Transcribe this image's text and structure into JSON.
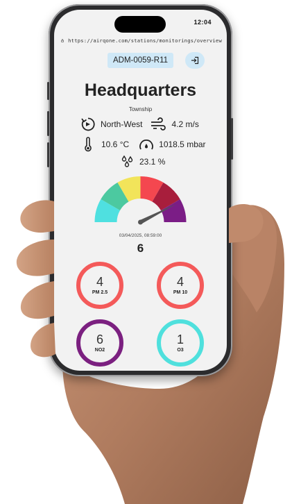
{
  "status_bar": {
    "time": "12:04"
  },
  "browser": {
    "url": "https://airqone.com/stations/monitorings/overview"
  },
  "header": {
    "station_id": "ADM-0059-R11",
    "logout_icon": "logout-icon"
  },
  "station": {
    "name": "Headquarters",
    "location": "Township"
  },
  "weather": {
    "wind_direction": "North-West",
    "wind_speed": "4.2 m/s",
    "temperature": "10.6 °C",
    "pressure": "1018.5 mbar",
    "humidity": "23.1 %"
  },
  "gauge": {
    "segment_colors": [
      "#4fe0e0",
      "#4cc9a0",
      "#f2e45a",
      "#f4474f",
      "#a81e3c",
      "#7b1d86"
    ],
    "needle_level": 0.85
  },
  "reading": {
    "timestamp": "03/04/2025, 08:59:00",
    "aqi": "6"
  },
  "pollutants": [
    {
      "value": "4",
      "label": "PM 2.5",
      "color": "#f45a5a"
    },
    {
      "value": "4",
      "label": "PM 10",
      "color": "#f45a5a"
    },
    {
      "value": "6",
      "label": "NO2",
      "color": "#7b2080"
    },
    {
      "value": "1",
      "label": "O3",
      "color": "#4fe0dd"
    }
  ]
}
